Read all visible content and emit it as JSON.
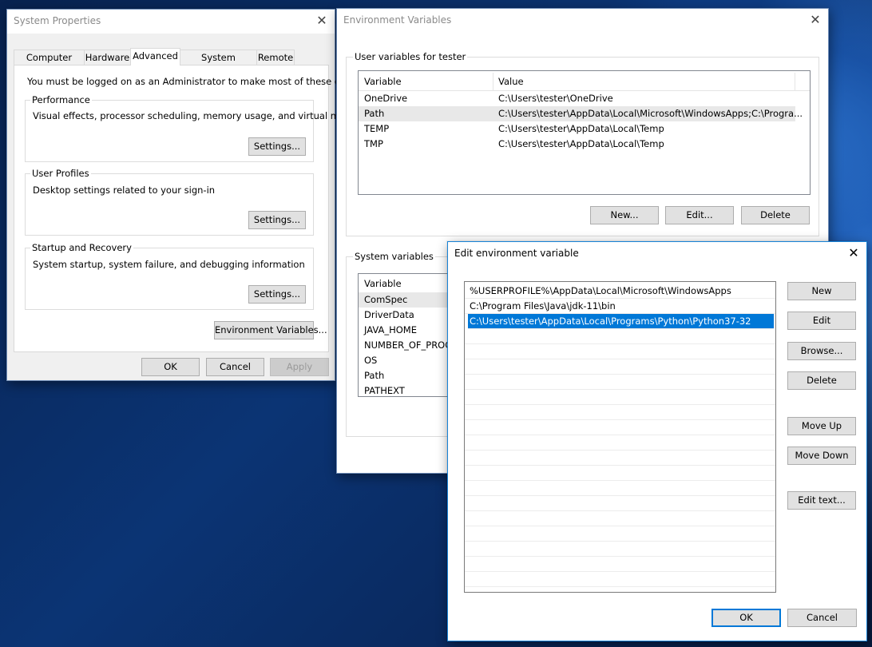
{
  "system_properties": {
    "title": "System Properties",
    "tabs": [
      "Computer Name",
      "Hardware",
      "Advanced",
      "System Protection",
      "Remote"
    ],
    "active_tab": "Advanced",
    "admin_notice": "You must be logged on as an Administrator to make most of these changes.",
    "performance": {
      "label": "Performance",
      "description": "Visual effects, processor scheduling, memory usage, and virtual memory",
      "settings_label": "Settings..."
    },
    "user_profiles": {
      "label": "User Profiles",
      "description": "Desktop settings related to your sign-in",
      "settings_label": "Settings..."
    },
    "startup_recovery": {
      "label": "Startup and Recovery",
      "description": "System startup, system failure, and debugging information",
      "settings_label": "Settings..."
    },
    "env_vars_button": "Environment Variables...",
    "ok": "OK",
    "cancel": "Cancel",
    "apply": "Apply"
  },
  "environment_variables": {
    "title": "Environment Variables",
    "user_group_label": "User variables for tester",
    "columns": {
      "variable": "Variable",
      "value": "Value"
    },
    "user_vars": [
      {
        "name": "OneDrive",
        "value": "C:\\Users\\tester\\OneDrive"
      },
      {
        "name": "Path",
        "value": "C:\\Users\\tester\\AppData\\Local\\Microsoft\\WindowsApps;C:\\Progra..."
      },
      {
        "name": "TEMP",
        "value": "C:\\Users\\tester\\AppData\\Local\\Temp"
      },
      {
        "name": "TMP",
        "value": "C:\\Users\\tester\\AppData\\Local\\Temp"
      }
    ],
    "user_buttons": {
      "new": "New...",
      "edit": "Edit...",
      "delete": "Delete"
    },
    "system_group_label": "System variables",
    "system_vars": [
      "ComSpec",
      "DriverData",
      "JAVA_HOME",
      "NUMBER_OF_PROC",
      "OS",
      "Path",
      "PATHEXT"
    ]
  },
  "edit_env_var": {
    "title": "Edit environment variable",
    "entries": [
      "%USERPROFILE%\\AppData\\Local\\Microsoft\\WindowsApps",
      "C:\\Program Files\\Java\\jdk-11\\bin",
      "C:\\Users\\tester\\AppData\\Local\\Programs\\Python\\Python37-32"
    ],
    "buttons": {
      "new": "New",
      "edit": "Edit",
      "browse": "Browse...",
      "delete": "Delete",
      "move_up": "Move Up",
      "move_down": "Move Down",
      "edit_text": "Edit text..."
    },
    "ok": "OK",
    "cancel": "Cancel"
  },
  "colors": {
    "selection_accent": "#0078d7",
    "dialog_background": "#f0f0f0",
    "desktop": "#0b3474"
  }
}
